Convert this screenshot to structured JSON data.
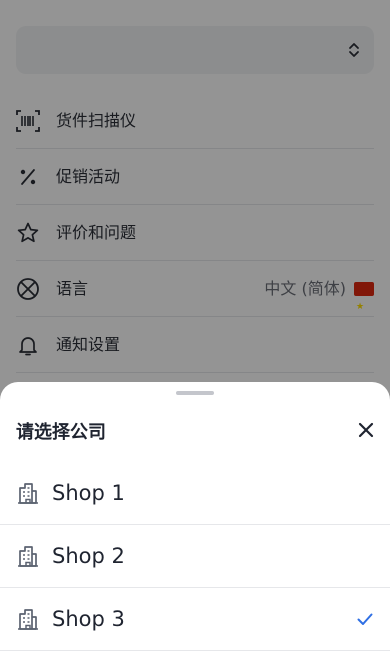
{
  "colors": {
    "overlay": "rgba(0,0,0,0.42)",
    "accent_check": "#2f6fe4",
    "icon_gray": "#5b6270",
    "text_dark": "#1f2430"
  },
  "settings": {
    "company_selector": {
      "icon": "chevron-up-down-icon"
    },
    "items": [
      {
        "label": "货件扫描仪",
        "icon": "barcode-scanner-icon"
      },
      {
        "label": "促销活动",
        "icon": "percent-icon"
      },
      {
        "label": "评价和问题",
        "icon": "star-icon"
      },
      {
        "label": "语言",
        "icon": "language-icon",
        "value": "中文 (简体)",
        "flag": "china-flag-icon"
      },
      {
        "label": "通知设置",
        "icon": "bell-icon"
      }
    ]
  },
  "sheet": {
    "title": "请选择公司",
    "close_icon": "close-icon",
    "shops": [
      {
        "name": "Shop 1",
        "icon": "building-icon",
        "selected": false
      },
      {
        "name": "Shop 2",
        "icon": "building-icon",
        "selected": false
      },
      {
        "name": "Shop 3",
        "icon": "building-icon",
        "selected": true
      }
    ]
  }
}
